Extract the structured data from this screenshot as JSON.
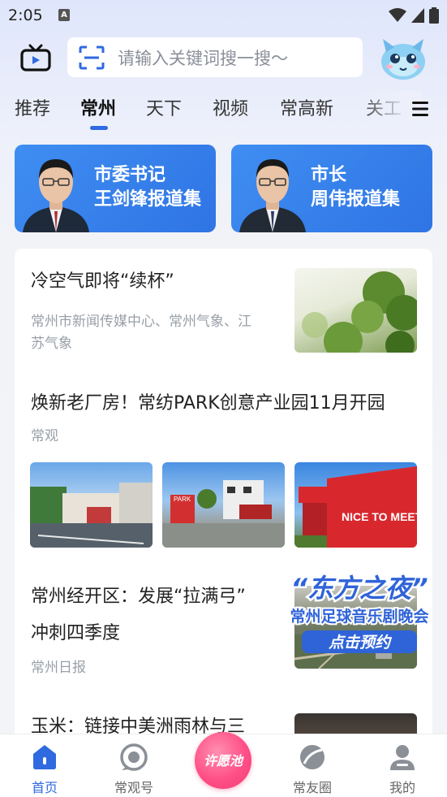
{
  "status_bar": {
    "time": "2:05",
    "notif_letter": "A"
  },
  "search": {
    "placeholder": "请输入关键词搜一搜～"
  },
  "tabs": [
    {
      "label": "推荐",
      "active": false
    },
    {
      "label": "常州",
      "active": true
    },
    {
      "label": "天下",
      "active": false
    },
    {
      "label": "视频",
      "active": false
    },
    {
      "label": "常高新",
      "active": false
    },
    {
      "label": "关工",
      "active": false
    }
  ],
  "banners": [
    {
      "line1": "市委书记",
      "line2": "王剑锋报道集"
    },
    {
      "line1": "市长",
      "line2": "周伟报道集"
    }
  ],
  "news": [
    {
      "title": "冷空气即将“续杯”",
      "source_line1": "常州市新闻传媒中心、常州气象、江",
      "source_line2": "苏气象"
    },
    {
      "title": "焕新老厂房！常纺PARK创意产业园11月开园",
      "source": "常观",
      "thumb_signs": [
        "PARK",
        "NICE TO MEET YOU"
      ]
    },
    {
      "title_line1": "常州经开区：发展“拉满弓”",
      "title_line2": "冲刺四季度",
      "source": "常州日报"
    },
    {
      "title": "玉米：链接中美洲雨林与三"
    }
  ],
  "promo": {
    "title": "“东方之夜”",
    "subtitle": "常州足球音乐剧晚会",
    "cta": "点击预约"
  },
  "bottom_nav": [
    {
      "label": "首页",
      "icon": "home-icon",
      "active": true
    },
    {
      "label": "常观号",
      "icon": "changguan-icon",
      "active": false
    },
    {
      "label": "常友圈",
      "icon": "circle-icon",
      "active": false
    },
    {
      "label": "我的",
      "icon": "profile-icon",
      "active": false
    }
  ],
  "wish_button": {
    "label": "许愿池"
  },
  "colors": {
    "accent": "#2f6ae0",
    "banner": "#3a86ee",
    "wish": "#ff5087"
  }
}
